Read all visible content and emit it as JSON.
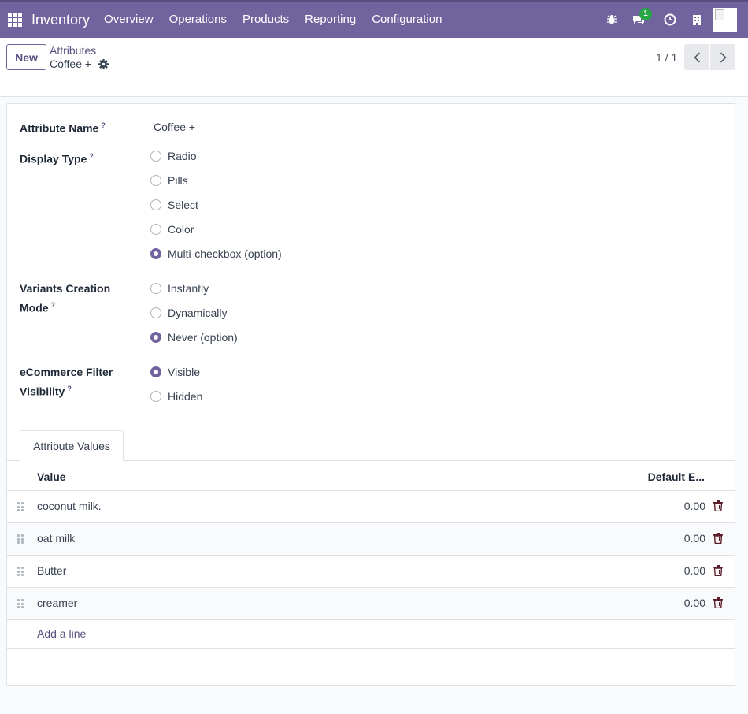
{
  "nav": {
    "app_name": "Inventory",
    "menu": [
      "Overview",
      "Operations",
      "Products",
      "Reporting",
      "Configuration"
    ],
    "message_count": "1"
  },
  "control": {
    "new_label": "New",
    "breadcrumb_parent": "Attributes",
    "breadcrumb_current": "Coffee +",
    "pager": "1 / 1"
  },
  "form": {
    "attribute_name_label": "Attribute Name",
    "attribute_name_value": "Coffee +",
    "display_type_label": "Display Type",
    "display_type_options": [
      "Radio",
      "Pills",
      "Select",
      "Color",
      "Multi-checkbox (option)"
    ],
    "display_type_selected": "Multi-checkbox (option)",
    "variants_label_1": "Variants Creation",
    "variants_label_2": "Mode",
    "variants_options": [
      "Instantly",
      "Dynamically",
      "Never (option)"
    ],
    "variants_selected": "Never (option)",
    "ecommerce_label_1": "eCommerce Filter",
    "ecommerce_label_2": "Visibility",
    "ecommerce_options": [
      "Visible",
      "Hidden"
    ],
    "ecommerce_selected": "Visible",
    "help_mark": "?"
  },
  "values_tab": {
    "tab_label": "Attribute Values",
    "col_value": "Value",
    "col_default": "Default E...",
    "rows": [
      {
        "value": "coconut milk.",
        "default_extra": "0.00"
      },
      {
        "value": "oat milk",
        "default_extra": "0.00"
      },
      {
        "value": "Butter",
        "default_extra": "0.00"
      },
      {
        "value": "creamer",
        "default_extra": "0.00"
      }
    ],
    "add_line": "Add a line"
  },
  "colors": {
    "brand": "#71639e",
    "badge": "#28a745"
  }
}
